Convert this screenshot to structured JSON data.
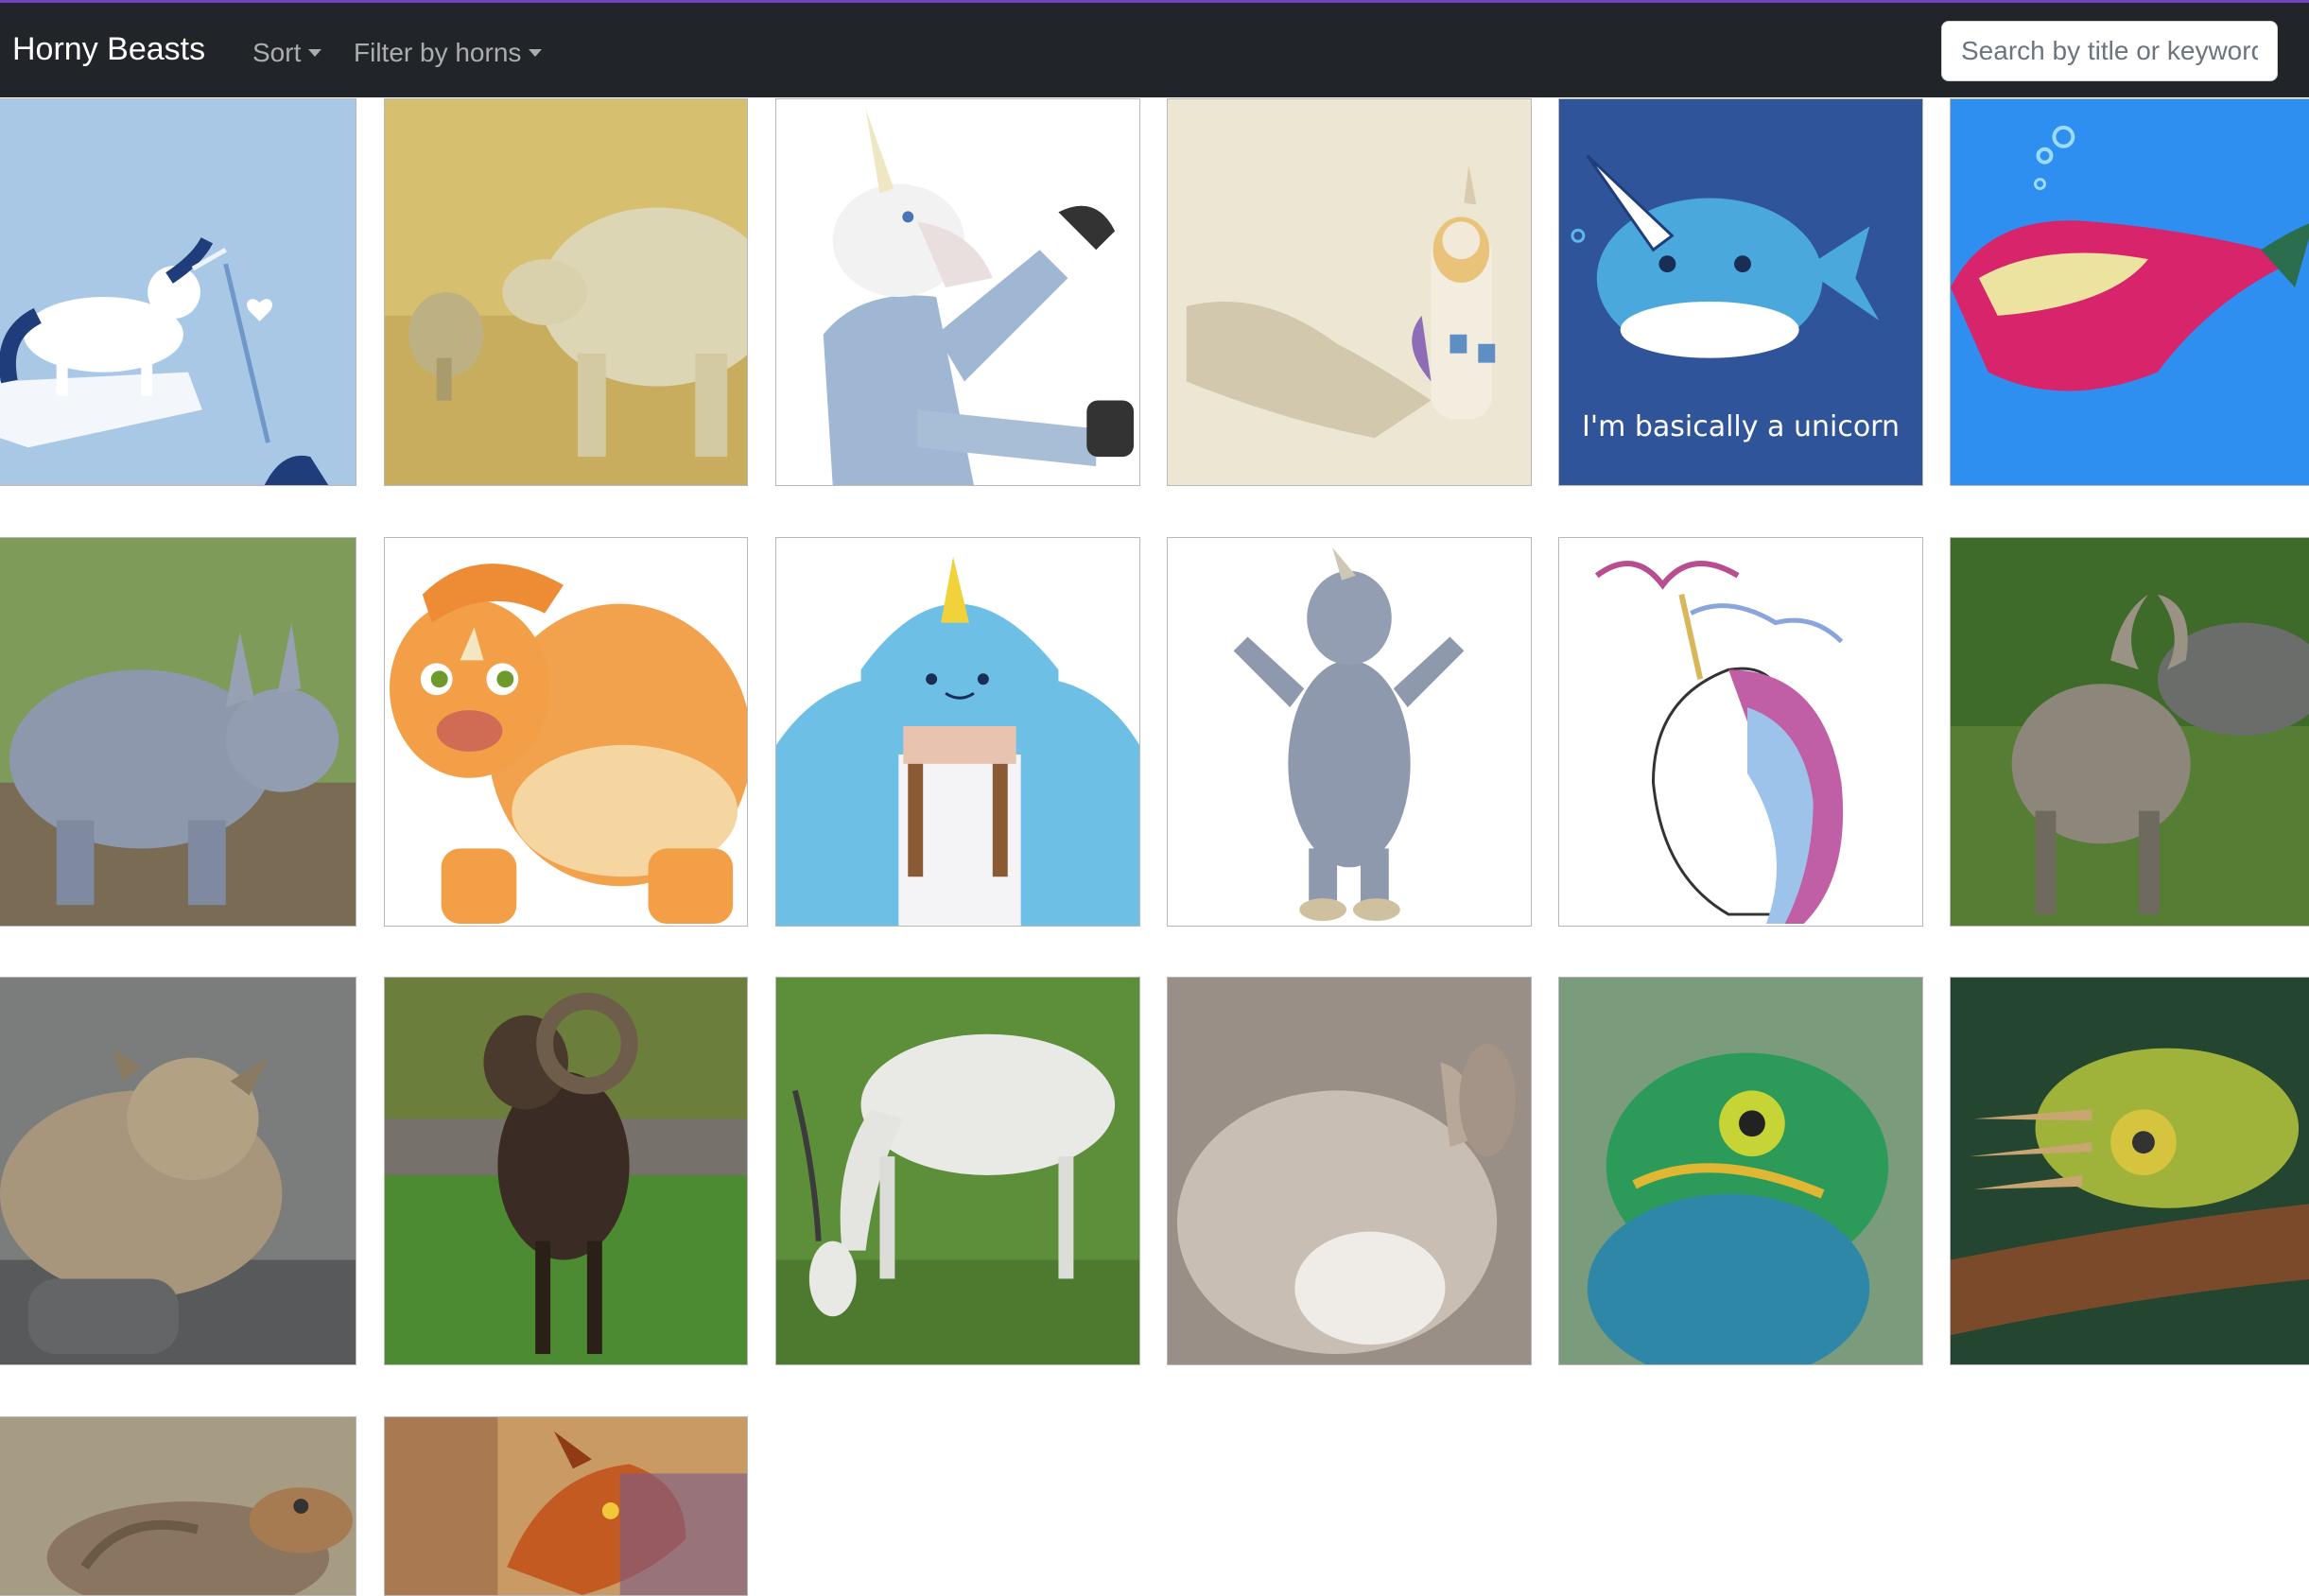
{
  "app": {
    "brand": "Horny Beasts",
    "nav": {
      "sort_label": "Sort",
      "filter_label": "Filter by horns"
    },
    "search": {
      "placeholder": "Search by title or keyword"
    },
    "accent_color": "#6f42c1",
    "navbar_color": "#212529"
  },
  "gallery": {
    "cards": [
      {
        "subject": "unicorn and narwhal illustration",
        "caption": ""
      },
      {
        "subject": "rhino with calf",
        "caption": ""
      },
      {
        "subject": "unicorn mask costume",
        "caption": ""
      },
      {
        "subject": "unicorn lego figure",
        "caption": ""
      },
      {
        "subject": "narwhal cartoon",
        "caption": "I'm basically a unicorn"
      },
      {
        "subject": "narwhal drawing",
        "caption": ""
      },
      {
        "subject": "baby rhino",
        "caption": ""
      },
      {
        "subject": "triceratops cartoon",
        "caption": ""
      },
      {
        "subject": "narwhal hoodie",
        "caption": ""
      },
      {
        "subject": "rhino mascot costume",
        "caption": ""
      },
      {
        "subject": "unicorn head drawing",
        "caption": ""
      },
      {
        "subject": "markhor goat",
        "caption": ""
      },
      {
        "subject": "baby goat",
        "caption": ""
      },
      {
        "subject": "mouflon ram",
        "caption": ""
      },
      {
        "subject": "addax antelope",
        "caption": ""
      },
      {
        "subject": "resting animal",
        "caption": ""
      },
      {
        "subject": "chameleon",
        "caption": ""
      },
      {
        "subject": "three-horned chameleon",
        "caption": ""
      },
      {
        "subject": "horned lizard",
        "caption": ""
      },
      {
        "subject": "dragon",
        "caption": ""
      }
    ]
  }
}
